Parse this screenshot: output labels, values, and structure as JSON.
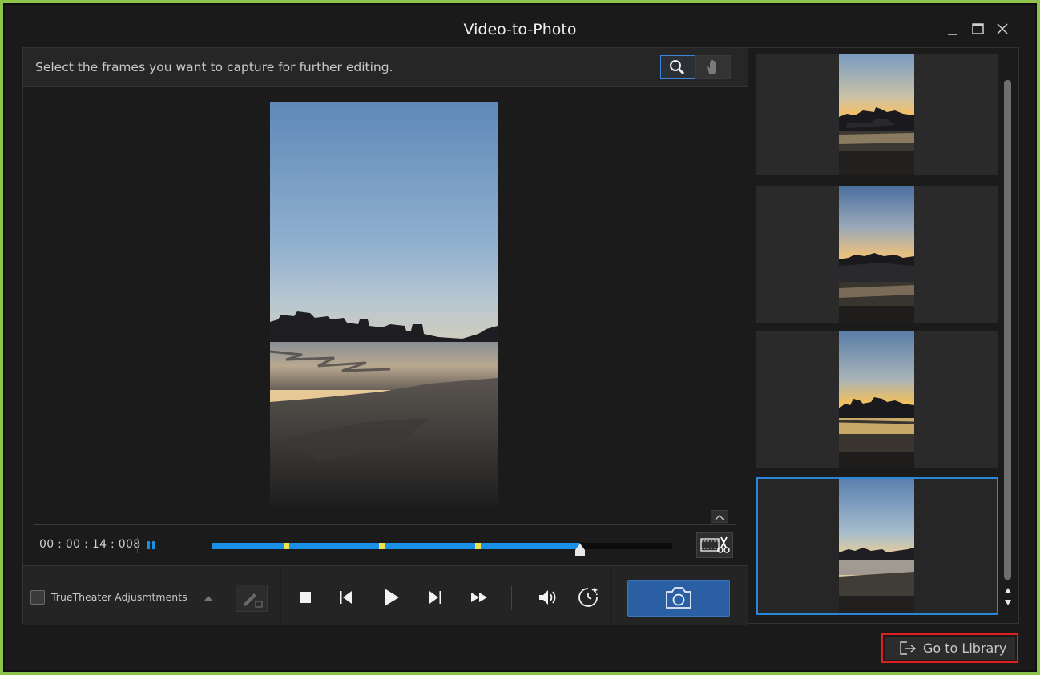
{
  "window": {
    "title": "Video-to-Photo",
    "controls": [
      "minimize-icon",
      "maximize-icon",
      "close-icon"
    ]
  },
  "capture_panel": {
    "instruction": "Select the frames you want to capture for further editing.",
    "tools": [
      {
        "name": "magnifier-icon",
        "active": true
      },
      {
        "name": "hand-icon",
        "active": false
      }
    ],
    "timecode": "00 : 00 : 14 : 008",
    "timeline": {
      "progress": 0.8,
      "markers": [
        0.155,
        0.363,
        0.572
      ],
      "fill_color": "#1a8fe6",
      "marker_color": "#f1e44a"
    },
    "trim_icon": "film-scissors-icon"
  },
  "controls": {
    "truetheater_label": "TrueTheater Adjusmtments",
    "truetheater_checked": false,
    "buttons": [
      "stop-icon",
      "previous-frame-icon",
      "play-icon",
      "next-frame-icon",
      "fast-forward-icon",
      "volume-icon",
      "playback-speed-icon"
    ],
    "capture_icon": "camera-icon",
    "capture_color": "#2b5fa3"
  },
  "thumbnails": {
    "count": 4,
    "selected_index": 3,
    "selected_color": "#2a86d9"
  },
  "footer": {
    "library_button": "Go to Library",
    "library_icon": "exit-arrow-icon",
    "highlight_color": "#e02020"
  }
}
